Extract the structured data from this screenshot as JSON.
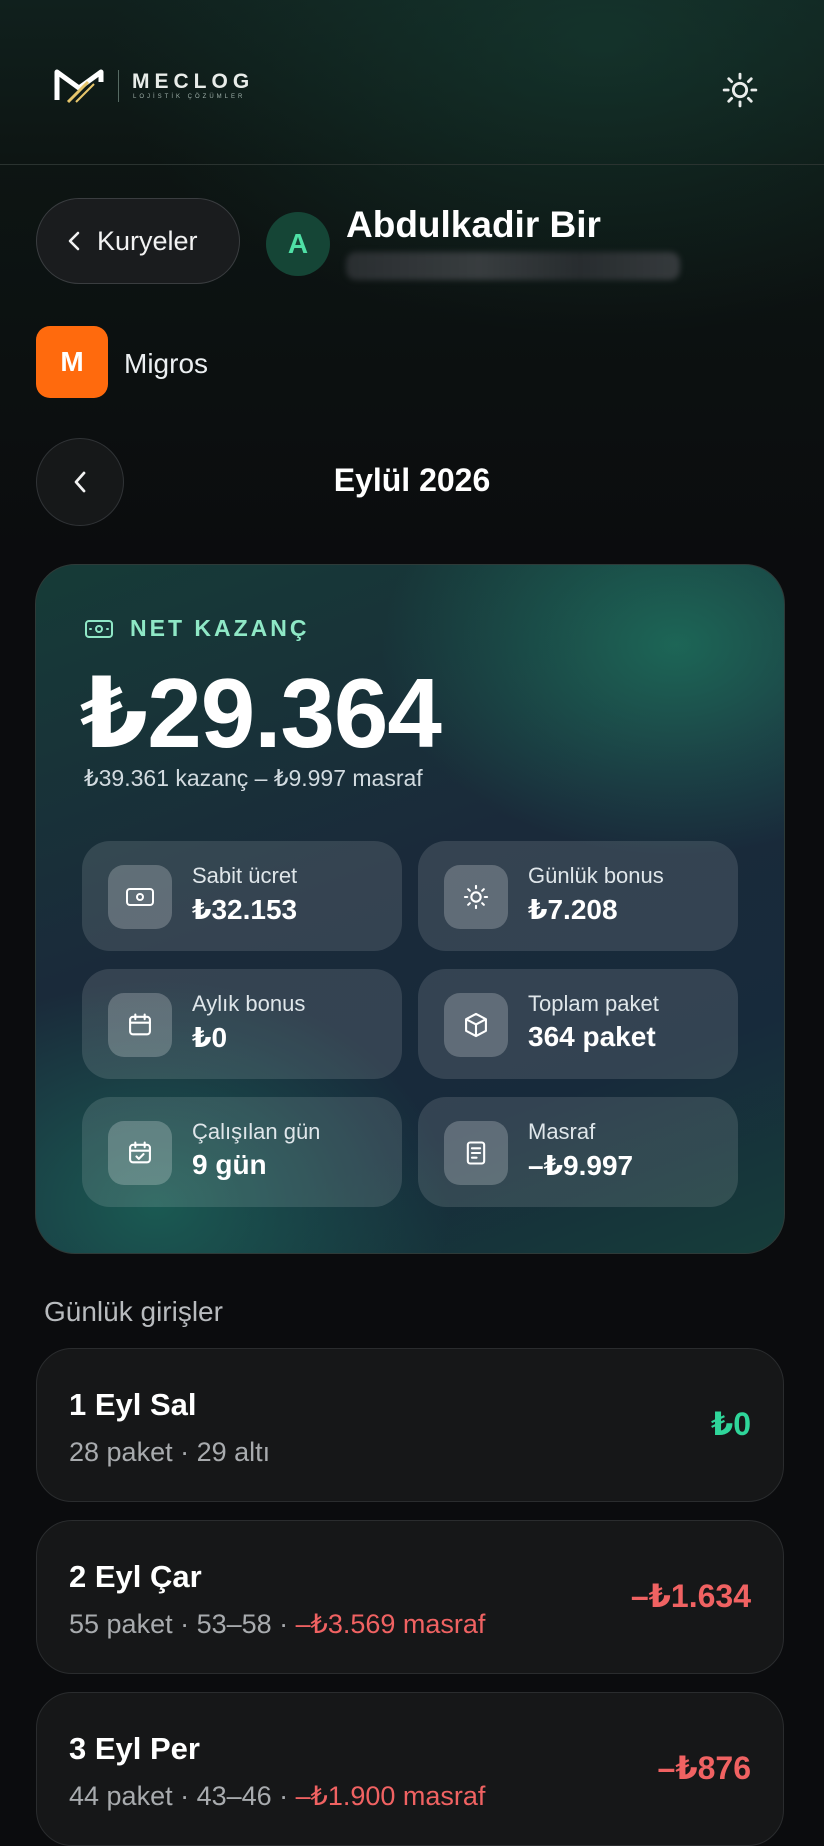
{
  "header": {
    "brand": "MECLOG",
    "tagline": "LOJİSTİK ÇÖZÜMLER",
    "logo_icon": "meclog-logo-icon",
    "theme_icon": "sun-icon"
  },
  "courier": {
    "back_label": "Kuryeler",
    "avatar_initial": "A",
    "name": "Abdulkadir Bir",
    "platform_initial": "M",
    "platform_name": "Migros"
  },
  "month": {
    "title": "Eylül 2026"
  },
  "summary": {
    "label": "NET KAZANÇ",
    "value": "₺29.364",
    "breakdown": "₺39.361 kazanç – ₺9.997 masraf",
    "tiles": [
      {
        "label": "Sabit ücret",
        "value": "₺32.153",
        "icon": "money-icon"
      },
      {
        "label": "Günlük bonus",
        "value": "₺7.208",
        "icon": "sun-icon"
      },
      {
        "label": "Aylık bonus",
        "value": "₺0",
        "icon": "calendar-icon"
      },
      {
        "label": "Toplam paket",
        "value": "364 paket",
        "icon": "package-icon"
      },
      {
        "label": "Çalışılan gün",
        "value": "9 gün",
        "icon": "calendar-check-icon"
      },
      {
        "label": "Masraf",
        "value": "–₺9.997",
        "icon": "receipt-icon"
      }
    ]
  },
  "daily": {
    "title": "Günlük girişler",
    "entries": [
      {
        "date": "1 Eyl Sal",
        "detail": "28 paket · 29 altı",
        "expense": "",
        "amount": "₺0"
      },
      {
        "date": "2 Eyl Çar",
        "detail": "55 paket · 53–58 · ",
        "expense": "–₺3.569 masraf",
        "amount": "–₺1.634"
      },
      {
        "date": "3 Eyl Per",
        "detail": "44 paket · 43–46 · ",
        "expense": "–₺1.900 masraf",
        "amount": "–₺876"
      }
    ]
  },
  "colors": {
    "accent": "#2fd69a",
    "negative": "#f06262",
    "platform": "#ff6a0d"
  }
}
